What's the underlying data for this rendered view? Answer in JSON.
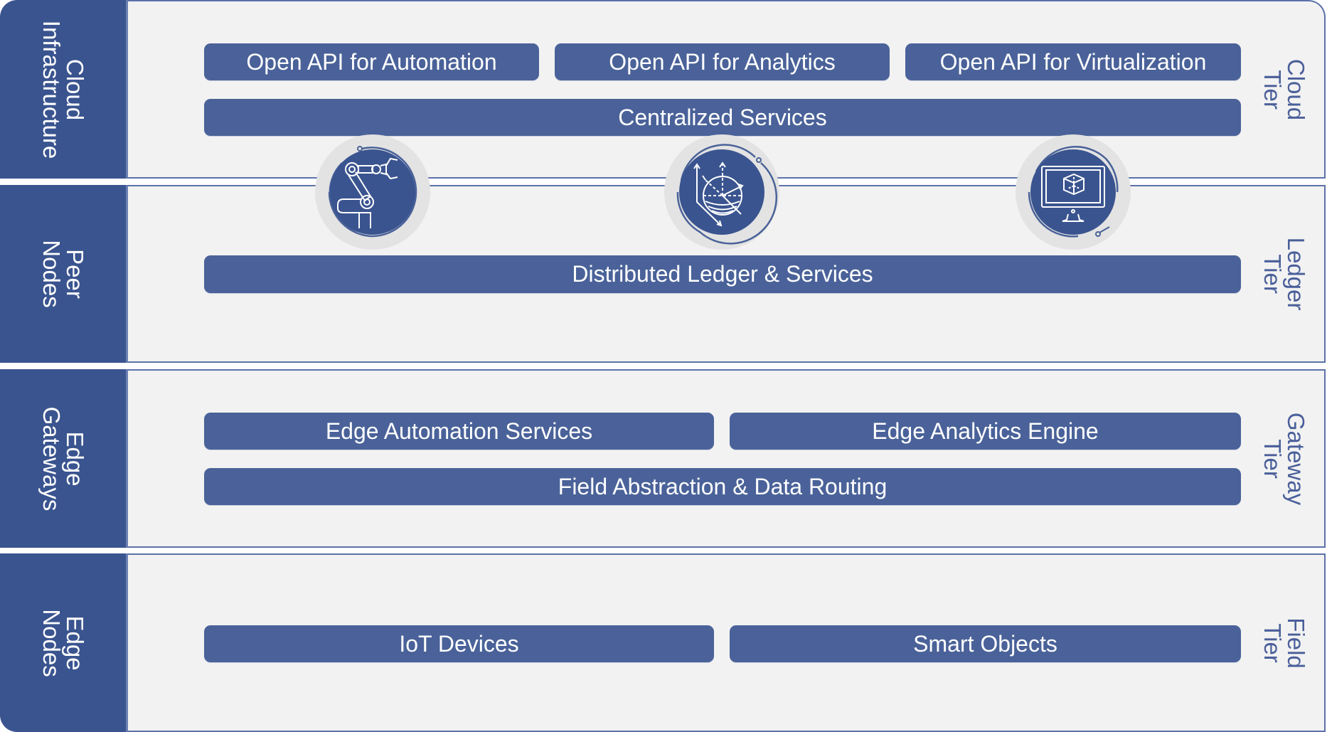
{
  "tiers": [
    {
      "left_label": [
        "Cloud",
        "Infrastructure"
      ],
      "right_label": [
        "Cloud",
        "Tier"
      ],
      "boxes_top": [
        "Open API for Automation",
        "Open API for Analytics",
        "Open API for Virtualization"
      ],
      "box_wide": "Centralized Services"
    },
    {
      "left_label": [
        "Peer",
        "Nodes"
      ],
      "right_label": [
        "Ledger",
        "Tier"
      ],
      "box_wide": "Distributed Ledger & Services"
    },
    {
      "left_label": [
        "Edge",
        "Gateways"
      ],
      "right_label": [
        "Gateway",
        "Tier"
      ],
      "boxes_top": [
        "Edge Automation Services",
        "Edge Analytics Engine"
      ],
      "box_wide": "Field Abstraction & Data Routing"
    },
    {
      "left_label": [
        "Edge",
        "Nodes"
      ],
      "right_label": [
        "Field",
        "Tier"
      ],
      "boxes_top": [
        "IoT Devices",
        "Smart Objects"
      ]
    }
  ],
  "icons": [
    "robot-arm-icon",
    "3d-sphere-axes-icon",
    "monitor-cube-icon"
  ],
  "colors": {
    "label_column": "#3a548f",
    "box_fill": "#4a6299",
    "panel_bg": "#f2f2f2",
    "border": "#5b71a8",
    "tier_text": "#4a5f9a"
  }
}
